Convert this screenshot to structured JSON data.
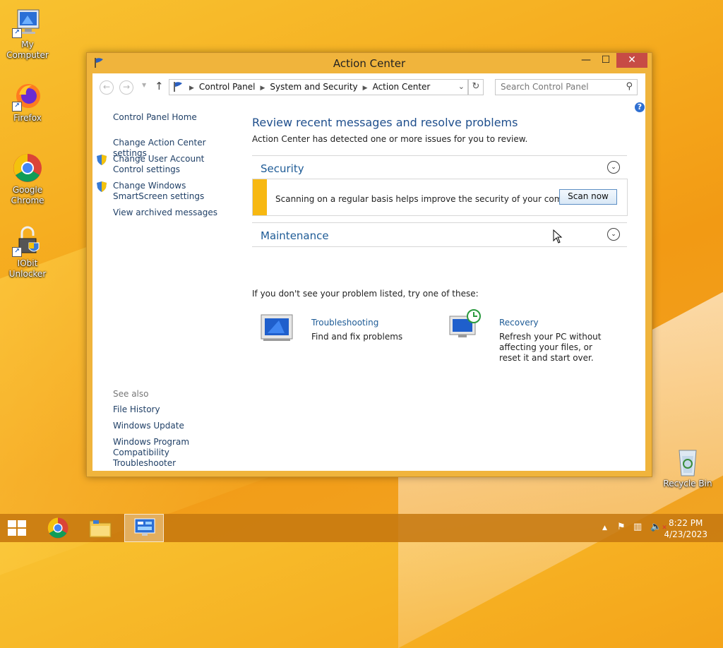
{
  "desktop": {
    "icons": [
      {
        "label": "My Computer"
      },
      {
        "label": "Firefox"
      },
      {
        "label": "Google Chrome"
      },
      {
        "label": "IObit Unlocker"
      },
      {
        "label": "Recycle Bin"
      }
    ]
  },
  "window": {
    "title": "Action Center",
    "buttons": {
      "minimize": "—",
      "maximize": "☐",
      "close": "✕"
    }
  },
  "navbar": {
    "breadcrumbs": [
      "Control Panel",
      "System and Security",
      "Action Center"
    ],
    "search_placeholder": "Search Control Panel"
  },
  "left_pane": {
    "links": [
      "Control Panel Home",
      "Change Action Center settings",
      "Change User Account Control settings",
      "Change Windows SmartScreen settings",
      "View archived messages"
    ],
    "see_also_title": "See also",
    "see_also": [
      "File History",
      "Windows Update",
      "Windows Program Compatibility Troubleshooter"
    ]
  },
  "main": {
    "heading": "Review recent messages and resolve problems",
    "subheading": "Action Center has detected one or more issues for you to review.",
    "sections": [
      {
        "label": "Security"
      },
      {
        "label": "Maintenance"
      }
    ],
    "alert": {
      "message": "Scanning on a regular basis helps improve the security of your computer.",
      "button": "Scan now"
    },
    "try_line": "If you don't see your problem listed, try one of these:",
    "tasks": [
      {
        "title": "Troubleshooting",
        "desc": "Find and fix problems"
      },
      {
        "title": "Recovery",
        "desc": "Refresh your PC without affecting your files, or reset it and start over."
      }
    ]
  },
  "taskbar": {
    "time": "8:22 PM",
    "date": "4/23/2023"
  },
  "colors": {
    "link": "#1e5b96",
    "alert_bar": "#f7b811",
    "close_button": "#c74b45",
    "wallpaper": "#f5a91d"
  }
}
